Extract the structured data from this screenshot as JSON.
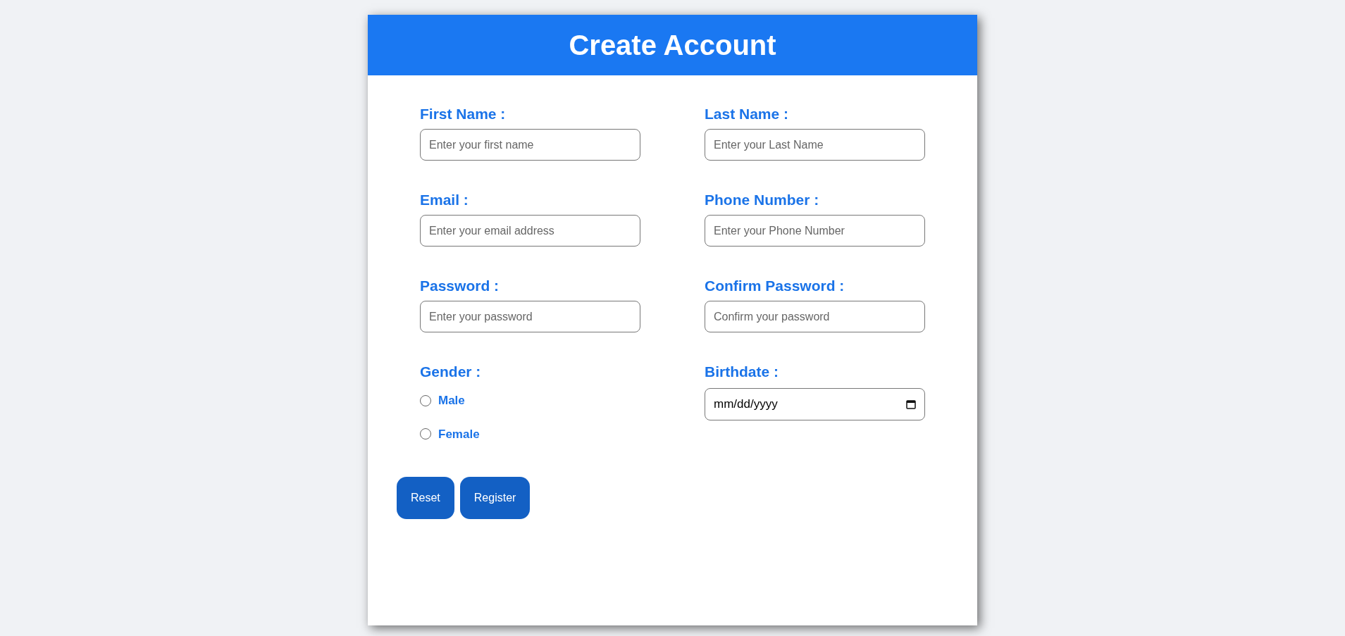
{
  "title": "Create Account",
  "fields": [
    {
      "kind": "text",
      "label": "First Name :",
      "placeholder": "Enter your first name"
    },
    {
      "kind": "text",
      "label": "Last Name :",
      "placeholder": "Enter your Last Name"
    },
    {
      "kind": "text",
      "label": "Email :",
      "placeholder": "Enter your email address"
    },
    {
      "kind": "text",
      "label": "Phone Number :",
      "placeholder": "Enter your Phone Number"
    },
    {
      "kind": "text",
      "label": "Password :",
      "placeholder": "Enter your password"
    },
    {
      "kind": "text",
      "label": "Confirm Password :",
      "placeholder": "Confirm your password"
    },
    {
      "kind": "radio",
      "label": "Gender :",
      "options": [
        {
          "label": "Male",
          "selected": false
        },
        {
          "label": "Female",
          "selected": false
        }
      ]
    },
    {
      "kind": "date",
      "label": "Birthdate :",
      "value": "mm/dd/yyyy"
    }
  ],
  "buttons": [
    "Reset",
    "Register"
  ]
}
